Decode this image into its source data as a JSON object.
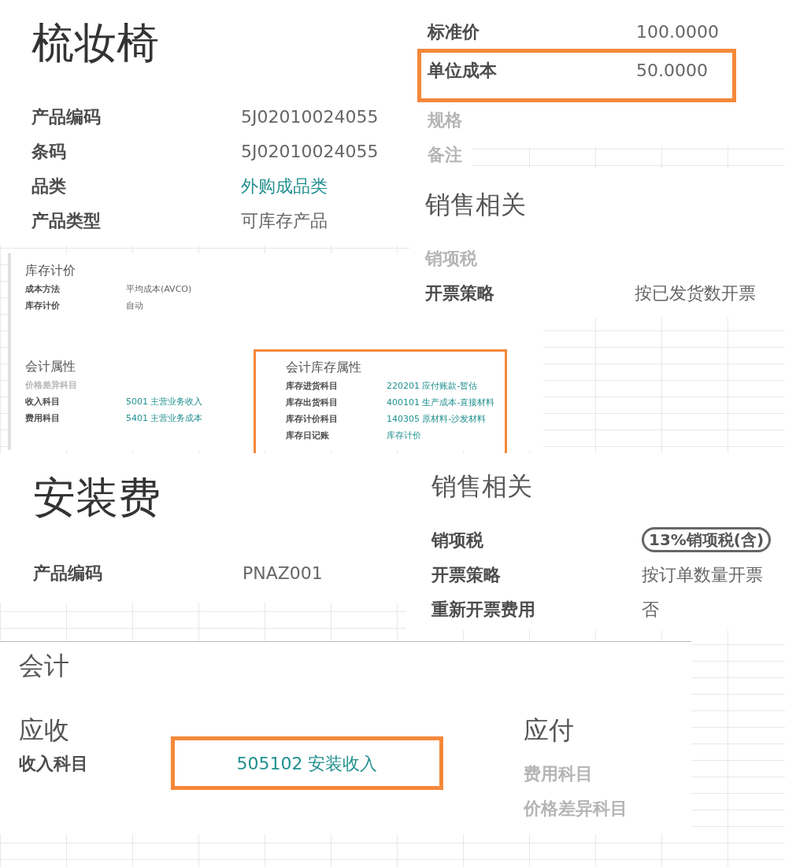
{
  "product_card": {
    "title": "梳妆椅",
    "fields": [
      {
        "label": "产品编码",
        "value": "5J02010024055",
        "muted": false,
        "link": false,
        "highlighted": false
      },
      {
        "label": "条码",
        "value": "5J02010024055",
        "muted": false,
        "link": false,
        "highlighted": false
      },
      {
        "label": "品类",
        "value": "外购成品类",
        "muted": false,
        "link": true,
        "highlighted": false
      },
      {
        "label": "产品类型",
        "value": "可库存产品",
        "muted": false,
        "link": false,
        "highlighted": false
      }
    ]
  },
  "price_card": {
    "fields": [
      {
        "label": "标准价",
        "value": "100.0000",
        "muted": false,
        "link": false,
        "highlighted": false
      },
      {
        "label": "单位成本",
        "value": "50.0000",
        "muted": false,
        "link": false,
        "highlighted": true
      },
      {
        "label": "规格",
        "muted": true,
        "highlighted": false
      },
      {
        "label": "备注",
        "muted": true,
        "highlighted": false
      }
    ],
    "sales_heading": "销售相关",
    "sales_fields": [
      {
        "label": "销项税",
        "muted": true,
        "highlighted": false
      },
      {
        "label": "开票策略",
        "value": "按已发货数开票",
        "muted": false,
        "link": false,
        "highlighted": false
      }
    ]
  },
  "inventory_card": {
    "valuation": {
      "heading": "库存计价",
      "highlighted": false,
      "fields": [
        {
          "label": "成本方法",
          "value": "平均成本(AVCO)",
          "muted": false,
          "link": false,
          "highlighted": false
        },
        {
          "label": "库存计价",
          "value": "自动",
          "muted": false,
          "link": false,
          "highlighted": false
        }
      ]
    },
    "accounting": {
      "heading": "会计属性",
      "highlighted": false,
      "fields": [
        {
          "label": "价格差异科目",
          "muted": true,
          "highlighted": false
        },
        {
          "label": "收入科目",
          "value": "5001 主营业务收入",
          "muted": false,
          "link": true,
          "highlighted": false
        },
        {
          "label": "费用科目",
          "value": "5401 主营业务成本",
          "muted": false,
          "link": true,
          "highlighted": false
        }
      ]
    },
    "stock_accounting": {
      "heading": "会计库存属性",
      "highlighted": true,
      "fields": [
        {
          "label": "库存进货科目",
          "value": "220201 应付账款-暂估",
          "muted": false,
          "link": true,
          "highlighted": false
        },
        {
          "label": "库存出货科目",
          "value": "400101 生产成本-直接材料",
          "muted": false,
          "link": true,
          "highlighted": false
        },
        {
          "label": "库存计价科目",
          "value": "140305 原材料-沙发材料",
          "muted": false,
          "link": true,
          "highlighted": false
        },
        {
          "label": "库存日记账",
          "value": "库存计价",
          "muted": false,
          "link": true,
          "highlighted": false
        }
      ]
    }
  },
  "service_card": {
    "title": "安装费",
    "fields": [
      {
        "label": "产品编码",
        "value": "PNAZ001",
        "muted": false,
        "link": false,
        "highlighted": false
      }
    ]
  },
  "service_sales": {
    "heading": "销售相关",
    "fields": [
      {
        "label": "销项税",
        "value": "13%销项税(含)",
        "kind": "tag",
        "muted": false
      },
      {
        "label": "开票策略",
        "value": "按订单数量开票",
        "kind": "text",
        "muted": false
      },
      {
        "label": "重新开票费用",
        "value": "否",
        "kind": "text",
        "muted": false
      }
    ]
  },
  "accounting_card": {
    "heading": "会计",
    "receivable": {
      "heading": "应收",
      "fields": [
        {
          "label": "收入科目",
          "value": "505102 安装收入",
          "muted": false,
          "link": true,
          "highlighted": true
        }
      ]
    },
    "payable": {
      "heading": "应付",
      "fields": [
        {
          "label": "费用科目",
          "muted": true,
          "highlighted": false
        },
        {
          "label": "价格差异科目",
          "muted": true,
          "highlighted": false
        }
      ]
    }
  }
}
